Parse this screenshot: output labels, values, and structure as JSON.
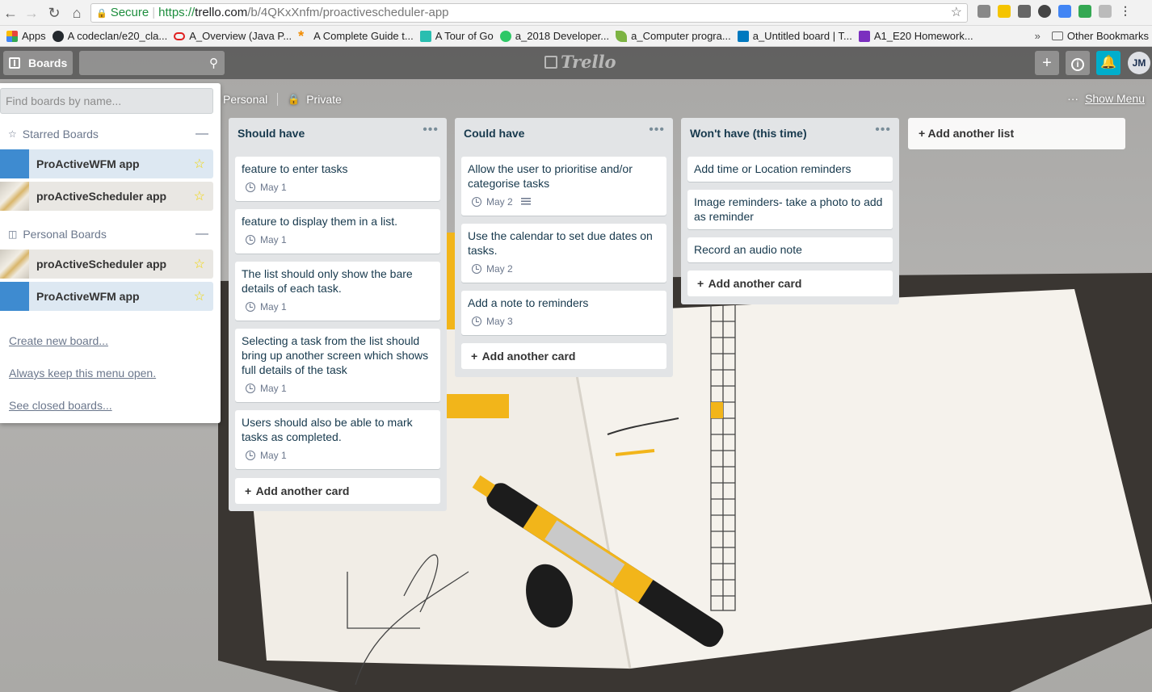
{
  "browser": {
    "secure_label": "Secure",
    "url_scheme": "https://",
    "url_host": "trello.com",
    "url_path": "/b/4QKxXnfm/proactivescheduler-app",
    "bookmarks": [
      {
        "label": "Apps",
        "icon": "apps-grid-icon",
        "color": "#e8453c"
      },
      {
        "label": "A codeclan/e20_cla...",
        "icon": "github-icon",
        "color": "#24292e"
      },
      {
        "label": "A_Overview (Java P...",
        "icon": "oracle-icon",
        "color": "#e01e1e"
      },
      {
        "label": "A Complete Guide t...",
        "icon": "asterisk-icon",
        "color": "#f28c00"
      },
      {
        "label": "A Tour of Go",
        "icon": "gopher-icon",
        "color": "#29beb0"
      },
      {
        "label": "a_2018 Developer...",
        "icon": "hackerrank-icon",
        "color": "#2ec866"
      },
      {
        "label": "a_Computer progra...",
        "icon": "leaf-icon",
        "color": "#7cb342"
      },
      {
        "label": "a_Untitled board | T...",
        "icon": "trello-icon",
        "color": "#0079bf"
      },
      {
        "label": "A1_E20 Homework...",
        "icon": "classroom-icon",
        "color": "#7b2fbf"
      }
    ],
    "other_bookmarks": "Other Bookmarks"
  },
  "header": {
    "boards_label": "Boards",
    "logo": "Trello",
    "avatar_initials": "JM"
  },
  "board": {
    "team": "Personal",
    "visibility": "Private",
    "show_menu": "Show Menu",
    "add_list": "+ Add another list"
  },
  "drawer": {
    "search_placeholder": "Find boards by name...",
    "starred_heading": "Starred Boards",
    "personal_heading": "Personal Boards",
    "starred": [
      "ProActiveWFM app",
      "proActiveScheduler app"
    ],
    "personal": [
      "proActiveScheduler app",
      "ProActiveWFM app"
    ],
    "links": [
      "Create new board...",
      "Always keep this menu open.",
      "See closed boards..."
    ]
  },
  "lists": [
    {
      "title": "Should have",
      "cards": [
        {
          "text": "feature to enter tasks",
          "due": "May 1"
        },
        {
          "text": "feature to display them in a list.",
          "due": "May 1"
        },
        {
          "text": "The list should only show the bare details of each task.",
          "due": "May 1"
        },
        {
          "text": "Selecting a task from the list should bring up another screen which shows full details of the task",
          "due": "May 1"
        },
        {
          "text": "Users should also be able to mark tasks as completed.",
          "due": "May 1"
        }
      ],
      "add_card": "Add another card"
    },
    {
      "title": "Could have",
      "cards": [
        {
          "text": "Allow the user to prioritise and/or categorise tasks",
          "due": "May 2"
        },
        {
          "text": "Use the calendar to set due dates on tasks.",
          "due": "May 2"
        },
        {
          "text": "Add a note to reminders",
          "due": "May 3"
        }
      ],
      "add_card": "Add another card"
    },
    {
      "title": "Won't have (this time)",
      "cards": [
        {
          "text": "Add time or Location reminders"
        },
        {
          "text": "Image reminders- take a photo to add as reminder"
        },
        {
          "text": "Record an audio note"
        }
      ],
      "add_card": "Add another card"
    }
  ],
  "colors": {
    "accent_blue": "#3e8bd0",
    "notification": "#00aecc",
    "star": "#f2d600",
    "list_bg": "#e2e4e6"
  }
}
